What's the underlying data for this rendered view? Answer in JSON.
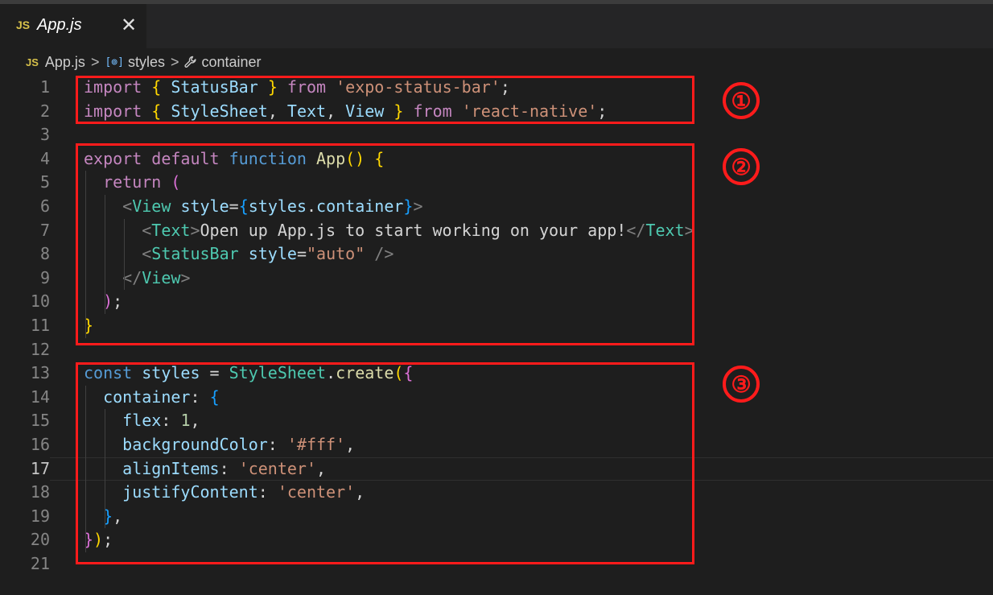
{
  "tab": {
    "lang_badge": "JS",
    "filename": "App.js",
    "close_glyph": "✕"
  },
  "breadcrumb": {
    "lang_badge": "JS",
    "file": "App.js",
    "sep": ">",
    "braces_icon": "[⊚]",
    "symbol1": "styles",
    "wrench_icon": "🔧",
    "symbol2": "container"
  },
  "editor": {
    "current_line": 17,
    "lines": [
      {
        "num": "1",
        "tokens": [
          [
            "kw",
            "import"
          ],
          [
            "pl",
            " "
          ],
          [
            "b1",
            "{"
          ],
          [
            "pl",
            " "
          ],
          [
            "var",
            "StatusBar"
          ],
          [
            "pl",
            " "
          ],
          [
            "b1",
            "}"
          ],
          [
            "pl",
            " "
          ],
          [
            "kw",
            "from"
          ],
          [
            "pl",
            " "
          ],
          [
            "str",
            "'expo-status-bar'"
          ],
          [
            "pl",
            ";"
          ]
        ]
      },
      {
        "num": "2",
        "tokens": [
          [
            "kw",
            "import"
          ],
          [
            "pl",
            " "
          ],
          [
            "b1",
            "{"
          ],
          [
            "pl",
            " "
          ],
          [
            "var",
            "StyleSheet"
          ],
          [
            "pl",
            ", "
          ],
          [
            "var",
            "Text"
          ],
          [
            "pl",
            ", "
          ],
          [
            "var",
            "View"
          ],
          [
            "pl",
            " "
          ],
          [
            "b1",
            "}"
          ],
          [
            "pl",
            " "
          ],
          [
            "kw",
            "from"
          ],
          [
            "pl",
            " "
          ],
          [
            "str",
            "'react-native'"
          ],
          [
            "pl",
            ";"
          ]
        ]
      },
      {
        "num": "3",
        "tokens": []
      },
      {
        "num": "4",
        "tokens": [
          [
            "kw",
            "export"
          ],
          [
            "pl",
            " "
          ],
          [
            "kw",
            "default"
          ],
          [
            "pl",
            " "
          ],
          [
            "bl",
            "function"
          ],
          [
            "pl",
            " "
          ],
          [
            "fn",
            "App"
          ],
          [
            "b1",
            "()"
          ],
          [
            "pl",
            " "
          ],
          [
            "b1",
            "{"
          ]
        ]
      },
      {
        "num": "5",
        "tokens": [
          [
            "pl",
            "  "
          ],
          [
            "kw",
            "return"
          ],
          [
            "pl",
            " "
          ],
          [
            "b2",
            "("
          ]
        ]
      },
      {
        "num": "6",
        "tokens": [
          [
            "pl",
            "    "
          ],
          [
            "tagb",
            "<"
          ],
          [
            "ty",
            "View"
          ],
          [
            "pl",
            " "
          ],
          [
            "var",
            "style"
          ],
          [
            "pl",
            "="
          ],
          [
            "b3",
            "{"
          ],
          [
            "var",
            "styles"
          ],
          [
            "pl",
            "."
          ],
          [
            "var",
            "container"
          ],
          [
            "b3",
            "}"
          ],
          [
            "tagb",
            ">"
          ]
        ]
      },
      {
        "num": "7",
        "tokens": [
          [
            "pl",
            "      "
          ],
          [
            "tagb",
            "<"
          ],
          [
            "ty",
            "Text"
          ],
          [
            "tagb",
            ">"
          ],
          [
            "pl",
            "Open up App.js to start working on your app!"
          ],
          [
            "tagb",
            "</"
          ],
          [
            "ty",
            "Text"
          ],
          [
            "tagb",
            ">"
          ]
        ]
      },
      {
        "num": "8",
        "tokens": [
          [
            "pl",
            "      "
          ],
          [
            "tagb",
            "<"
          ],
          [
            "ty",
            "StatusBar"
          ],
          [
            "pl",
            " "
          ],
          [
            "var",
            "style"
          ],
          [
            "pl",
            "="
          ],
          [
            "str",
            "\"auto\""
          ],
          [
            "pl",
            " "
          ],
          [
            "tagb",
            "/>"
          ]
        ]
      },
      {
        "num": "9",
        "tokens": [
          [
            "pl",
            "    "
          ],
          [
            "tagb",
            "</"
          ],
          [
            "ty",
            "View"
          ],
          [
            "tagb",
            ">"
          ]
        ]
      },
      {
        "num": "10",
        "tokens": [
          [
            "pl",
            "  "
          ],
          [
            "b2",
            ")"
          ],
          [
            "pl",
            ";"
          ]
        ]
      },
      {
        "num": "11",
        "tokens": [
          [
            "b1",
            "}"
          ]
        ]
      },
      {
        "num": "12",
        "tokens": []
      },
      {
        "num": "13",
        "tokens": [
          [
            "bl",
            "const"
          ],
          [
            "pl",
            " "
          ],
          [
            "var",
            "styles"
          ],
          [
            "pl",
            " = "
          ],
          [
            "ty",
            "StyleSheet"
          ],
          [
            "pl",
            "."
          ],
          [
            "fn",
            "create"
          ],
          [
            "b1",
            "("
          ],
          [
            "b2",
            "{"
          ]
        ]
      },
      {
        "num": "14",
        "tokens": [
          [
            "pl",
            "  "
          ],
          [
            "var",
            "container"
          ],
          [
            "pl",
            ": "
          ],
          [
            "b3",
            "{"
          ]
        ]
      },
      {
        "num": "15",
        "tokens": [
          [
            "pl",
            "    "
          ],
          [
            "var",
            "flex"
          ],
          [
            "pl",
            ": "
          ],
          [
            "num",
            "1"
          ],
          [
            "pl",
            ","
          ]
        ]
      },
      {
        "num": "16",
        "tokens": [
          [
            "pl",
            "    "
          ],
          [
            "var",
            "backgroundColor"
          ],
          [
            "pl",
            ": "
          ],
          [
            "str",
            "'#fff'"
          ],
          [
            "pl",
            ","
          ]
        ]
      },
      {
        "num": "17",
        "tokens": [
          [
            "pl",
            "    "
          ],
          [
            "var",
            "alignItems"
          ],
          [
            "pl",
            ": "
          ],
          [
            "str",
            "'center'"
          ],
          [
            "pl",
            ","
          ]
        ]
      },
      {
        "num": "18",
        "tokens": [
          [
            "pl",
            "    "
          ],
          [
            "var",
            "justifyContent"
          ],
          [
            "pl",
            ": "
          ],
          [
            "str",
            "'center'"
          ],
          [
            "pl",
            ","
          ]
        ]
      },
      {
        "num": "19",
        "tokens": [
          [
            "pl",
            "  "
          ],
          [
            "b3",
            "}"
          ],
          [
            "pl",
            ","
          ]
        ]
      },
      {
        "num": "20",
        "tokens": [
          [
            "b2",
            "}"
          ],
          [
            "b1",
            ")"
          ],
          [
            "pl",
            ";"
          ]
        ]
      },
      {
        "num": "21",
        "tokens": []
      }
    ]
  },
  "annotations": [
    {
      "label": "①",
      "color": "#ff1b1b"
    },
    {
      "label": "②",
      "color": "#ff1b1b"
    },
    {
      "label": "③",
      "color": "#ff1b1b"
    }
  ]
}
